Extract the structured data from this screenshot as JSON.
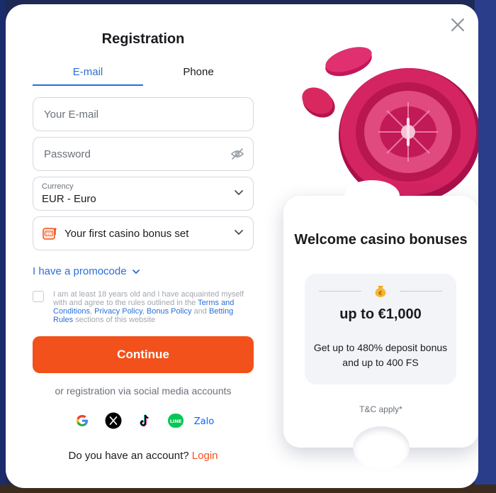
{
  "title": "Registration",
  "tabs": [
    {
      "label": "E-mail",
      "active": true
    },
    {
      "label": "Phone",
      "active": false
    }
  ],
  "fields": {
    "email_placeholder": "Your E-mail",
    "password_placeholder": "Password",
    "currency_label": "Currency",
    "currency_value": "EUR - Euro",
    "bonus_value": "Your first casino bonus set"
  },
  "promo_label": "I have a promocode",
  "consent": {
    "text_before": "I am at least 18 years old and I have acquainted myself with and agree to the rules outlined in the ",
    "terms": "Terms and Conditions",
    "sep1": ", ",
    "privacy": "Privacy Policy",
    "sep2": ", ",
    "bonus_policy": "Bonus Policy",
    "and": " and ",
    "betting_rules": "Betting Rules",
    "text_after": " sections of this website"
  },
  "continue_label": "Continue",
  "social_title": "or registration via social media accounts",
  "socials": [
    {
      "name": "google-icon"
    },
    {
      "name": "x-icon"
    },
    {
      "name": "tiktok-icon"
    },
    {
      "name": "line-icon",
      "text": "LINE"
    },
    {
      "name": "zalo-icon",
      "text": "Zalo"
    }
  ],
  "account": {
    "question": "Do you have an account?",
    "login": "Login"
  },
  "promo_card": {
    "title": "Welcome casino bonuses",
    "amount": "up to €1,000",
    "description": "Get up to 480% deposit bonus and up to 400 FS",
    "tc": "T&C apply*"
  },
  "colors": {
    "accent": "#2a6fd6",
    "cta": "#f2511b",
    "roulette": "#c2185b"
  }
}
